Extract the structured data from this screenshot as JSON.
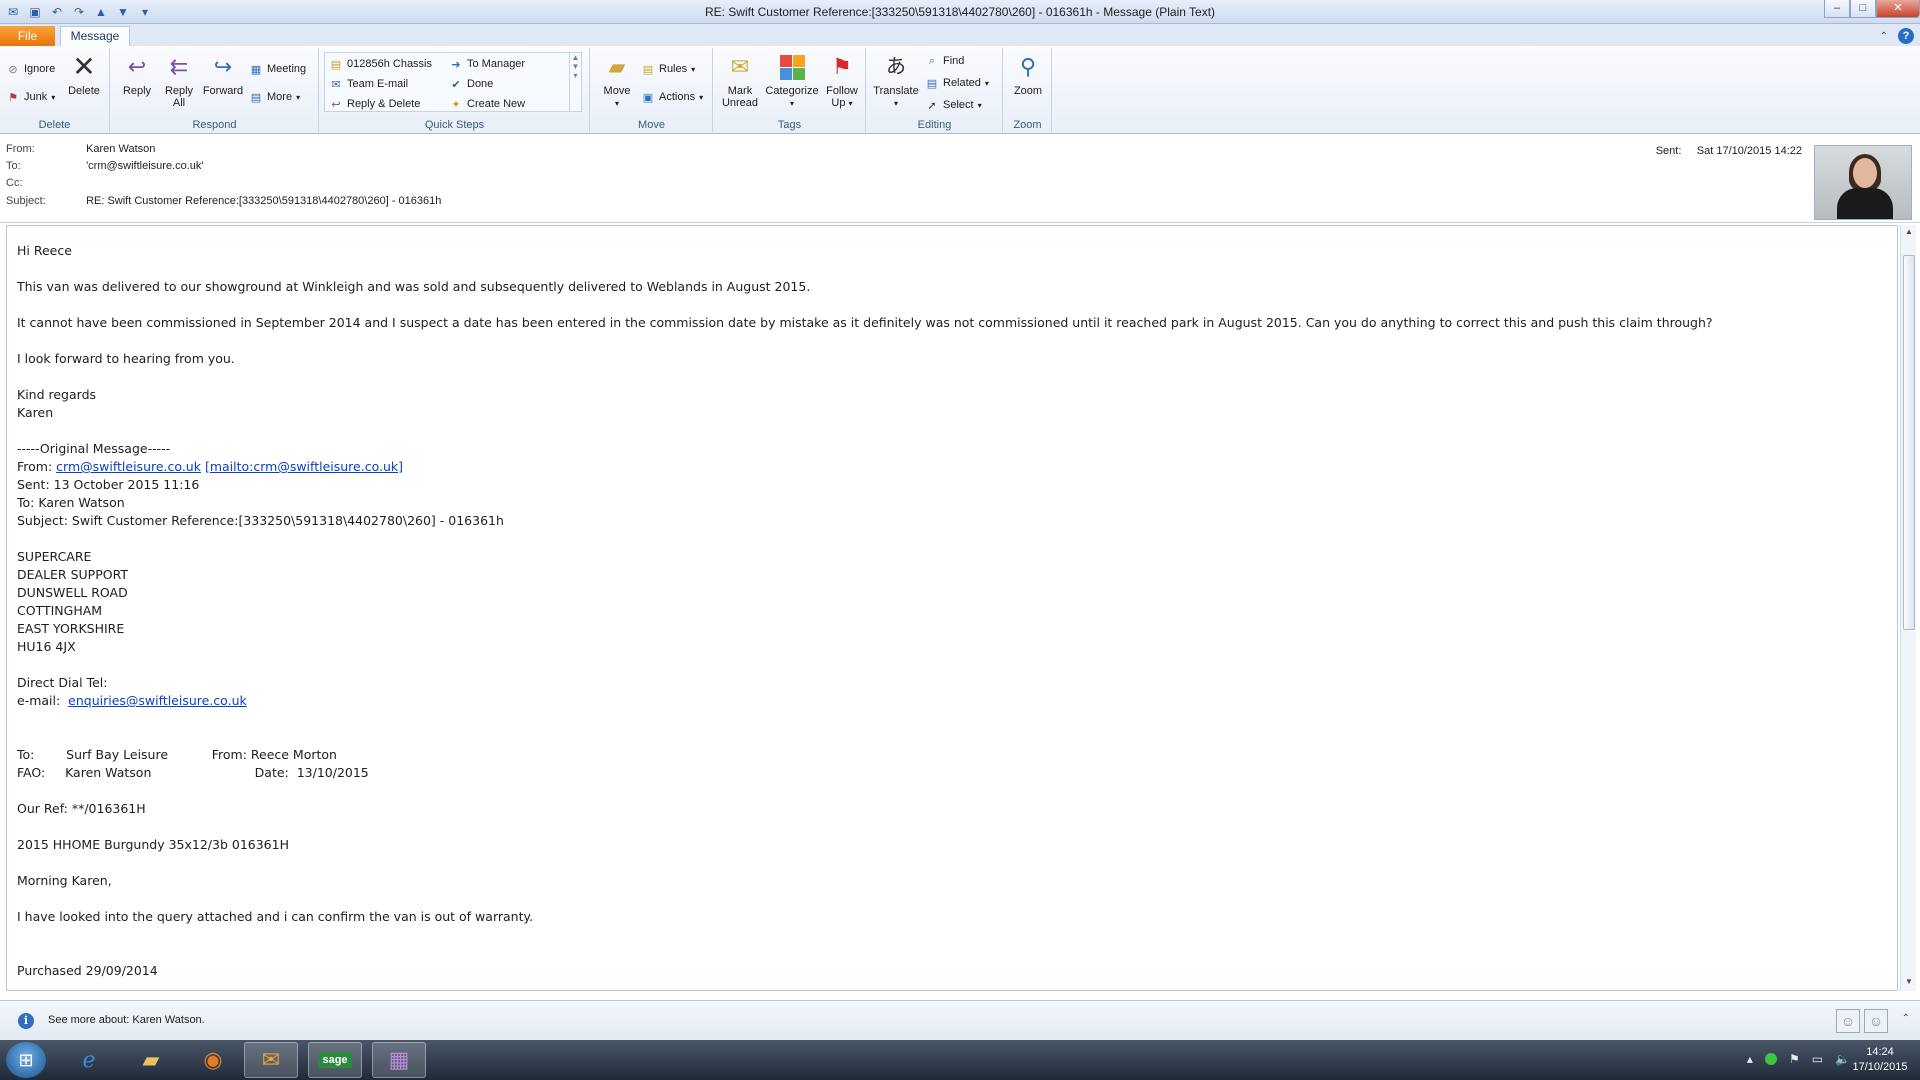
{
  "window": {
    "title": "RE: Swift Customer Reference:[333250\\591318\\4402780\\260] - 016361h  -  Message (Plain Text)",
    "controls": {
      "minimize": "–",
      "maximize": "□",
      "close": "✕"
    }
  },
  "tabs": {
    "file": "File",
    "message": "Message"
  },
  "ribbon": {
    "delete_group": {
      "label": "Delete",
      "ignore": "Ignore",
      "junk": "Junk",
      "delete": "Delete"
    },
    "respond_group": {
      "label": "Respond",
      "reply": "Reply",
      "reply_all_1": "Reply",
      "reply_all_2": "All",
      "forward": "Forward",
      "meeting": "Meeting",
      "more": "More"
    },
    "quick_steps_group": {
      "label": "Quick Steps",
      "items": [
        "012856h Chassis",
        "Team E-mail",
        "Reply & Delete",
        "To Manager",
        "Done",
        "Create New"
      ]
    },
    "move_group": {
      "label": "Move",
      "move": "Move",
      "rules": "Rules",
      "actions": "Actions"
    },
    "tags_group": {
      "label": "Tags",
      "mark_unread_1": "Mark",
      "mark_unread_2": "Unread",
      "categorize": "Categorize",
      "follow_up_1": "Follow",
      "follow_up_2": "Up"
    },
    "editing_group": {
      "label": "Editing",
      "translate": "Translate",
      "find": "Find",
      "related": "Related",
      "select": "Select"
    },
    "zoom_group": {
      "label": "Zoom",
      "zoom": "Zoom"
    }
  },
  "header": {
    "from_label": "From:",
    "from": "Karen Watson",
    "to_label": "To:",
    "to": "'crm@swiftleisure.co.uk'",
    "cc_label": "Cc:",
    "cc": "",
    "subject_label": "Subject:",
    "subject": "RE: Swift Customer Reference:[333250\\591318\\4402780\\260] - 016361h",
    "sent_label": "Sent:",
    "sent": "Sat 17/10/2015 14:22"
  },
  "message": {
    "greeting": "Hi Reece",
    "p1": "This van was delivered to our showground at Winkleigh and was sold and subsequently delivered to Weblands in August 2015.",
    "p2": "It cannot have been commissioned in September 2014 and I suspect a date has been entered in the commission date by mistake as it definitely was not commissioned until it reached park in August 2015. Can you do anything to correct this and push this claim through?",
    "p3": "I look forward to hearing from you.",
    "regards": "Kind regards",
    "signature": "Karen",
    "original_sep": "-----Original Message-----",
    "orig_from_label": "From: ",
    "orig_from_link": "crm@swiftleisure.co.uk",
    "orig_from_mailto": "[mailto:crm@swiftleisure.co.uk]",
    "orig_sent": "Sent: 13 October 2015 11:16",
    "orig_to": "To: Karen Watson",
    "orig_subject": "Subject: Swift Customer Reference:[333250\\591318\\4402780\\260] - 016361h",
    "addr1": "SUPERCARE",
    "addr2": "DEALER SUPPORT",
    "addr3": "DUNSWELL ROAD",
    "addr4": "COTTINGHAM",
    "addr5": "EAST YORKSHIRE",
    "addr6": "HU16 4JX",
    "direct_dial": "Direct Dial Tel:",
    "email_label": "e-mail:  ",
    "email_link": "enquiries@swiftleisure.co.uk",
    "to_line": "To:        Surf Bay Leisure           From: Reece Morton",
    "fao_line": "FAO:     Karen Watson                          Date:  13/10/2015",
    "our_ref": "Our Ref: **/016361H",
    "model": "2015 HHOME Burgundy 35x12/3b 016361H",
    "morning": "Morning Karen,",
    "looked": "I have looked into the query attached and i can confirm the van is out of warranty.",
    "purchased": "Purchased 29/09/2014"
  },
  "people_pane": {
    "text": "See more about: Karen Watson."
  },
  "taskbar": {
    "time": "14:24",
    "date": "17/10/2015",
    "sage": "sage"
  }
}
